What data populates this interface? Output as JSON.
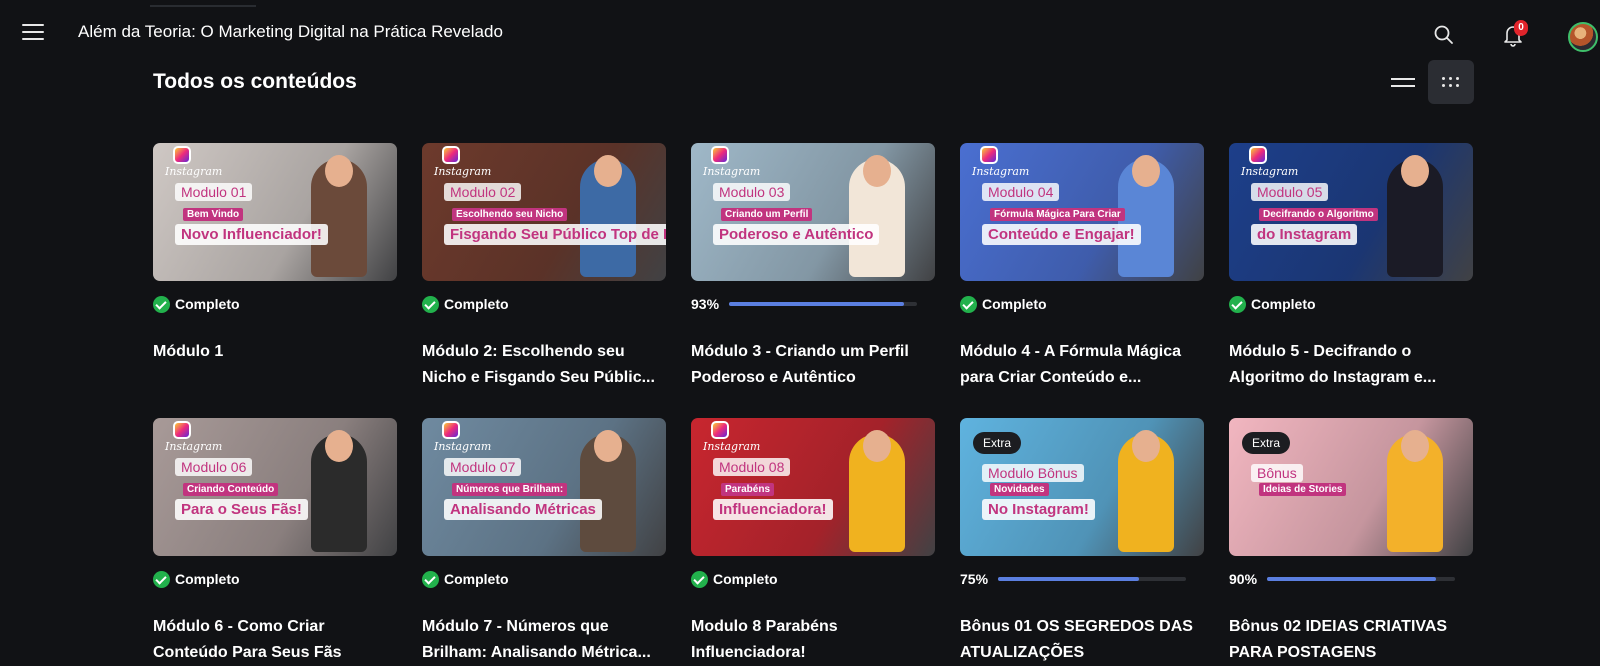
{
  "header": {
    "title": "Além da Teoria: O Marketing Digital na Prática Revelado",
    "notifications_count": "0"
  },
  "section": {
    "title": "Todos os conteúdos"
  },
  "cards": [
    {
      "title": "Módulo 1",
      "status": "Completo",
      "progress": 100,
      "thumb": {
        "tag": "Modulo 01",
        "sub1": "Bem Vindo",
        "sub2": "Novo Influenciador!",
        "bg": "#cfc8c4",
        "extra": ""
      }
    },
    {
      "title": "Módulo 2: Escolhendo seu Nicho e Fisgando Seu Públic...",
      "status": "Completo",
      "progress": 100,
      "thumb": {
        "tag": "Modulo 02",
        "sub1": "Escolhendo seu Nicho",
        "sub2": "Fisgando Seu Público Top de Linha",
        "bg": "#6d3a2c",
        "extra": ""
      }
    },
    {
      "title": "Módulo 3 - Criando um Perfil Poderoso e Autêntico",
      "status": "",
      "progress": 93,
      "progress_label": "93%",
      "thumb": {
        "tag": "Modulo 03",
        "sub1": "Criando um Perfil",
        "sub2": "Poderoso e Autêntico",
        "bg": "#9fb8c8",
        "extra": ""
      }
    },
    {
      "title": "Módulo 4 - A Fórmula Mágica para Criar Conteúdo e...",
      "status": "Completo",
      "progress": 100,
      "thumb": {
        "tag": "Modulo 04",
        "sub1": "Fórmula Mágica Para Criar",
        "sub2": "Conteúdo e Engajar!",
        "bg": "#4a6fd1",
        "extra": ""
      }
    },
    {
      "title": "Módulo 5 - Decifrando o Algoritmo do Instagram e...",
      "status": "Completo",
      "progress": 100,
      "thumb": {
        "tag": "Modulo 05",
        "sub1": "Decifrando o Algoritmo",
        "sub2": "do Instagram",
        "bg": "#1d3f8a",
        "extra": ""
      }
    },
    {
      "title": "Módulo 6 - Como Criar Conteúdo Para Seus Fãs",
      "status": "Completo",
      "progress": 100,
      "thumb": {
        "tag": "Modulo 06",
        "sub1": "Criando Conteúdo",
        "sub2": "Para o Seus Fãs!",
        "bg": "#a89a98",
        "extra": ""
      }
    },
    {
      "title": "Módulo 7 - Números que Brilham: Analisando Métrica...",
      "status": "Completo",
      "progress": 100,
      "thumb": {
        "tag": "Modulo 07",
        "sub1": "Números que Brilham:",
        "sub2": "Analisando Métricas",
        "bg": "#6f8aa0",
        "extra": ""
      }
    },
    {
      "title": "Modulo 8 Parabéns Influenciadora!",
      "status": "Completo",
      "progress": 100,
      "thumb": {
        "tag": "Modulo 08",
        "sub1": "Parabéns",
        "sub2": "Influenciadora!",
        "bg": "#c8262f",
        "extra": ""
      }
    },
    {
      "title": "Bônus 01 OS SEGREDOS DAS ATUALIZAÇÕES",
      "status": "",
      "progress": 75,
      "progress_label": "75%",
      "thumb": {
        "tag": "Modulo Bônus",
        "sub1": "Novidades",
        "sub2": "No Instagram!",
        "bg": "#5fb3df",
        "extra": "Extra"
      }
    },
    {
      "title": "Bônus 02 IDEIAS CRIATIVAS PARA POSTAGENS",
      "status": "",
      "progress": 90,
      "progress_label": "90%",
      "thumb": {
        "tag": "Bônus",
        "sub1": "Ideias de Stories",
        "sub2": "",
        "bg": "#f2b6c0",
        "extra": "Extra"
      }
    }
  ],
  "colors": {
    "complete": "#22b14c",
    "progress": "#5b7fe0",
    "accent": "#c1347f"
  }
}
